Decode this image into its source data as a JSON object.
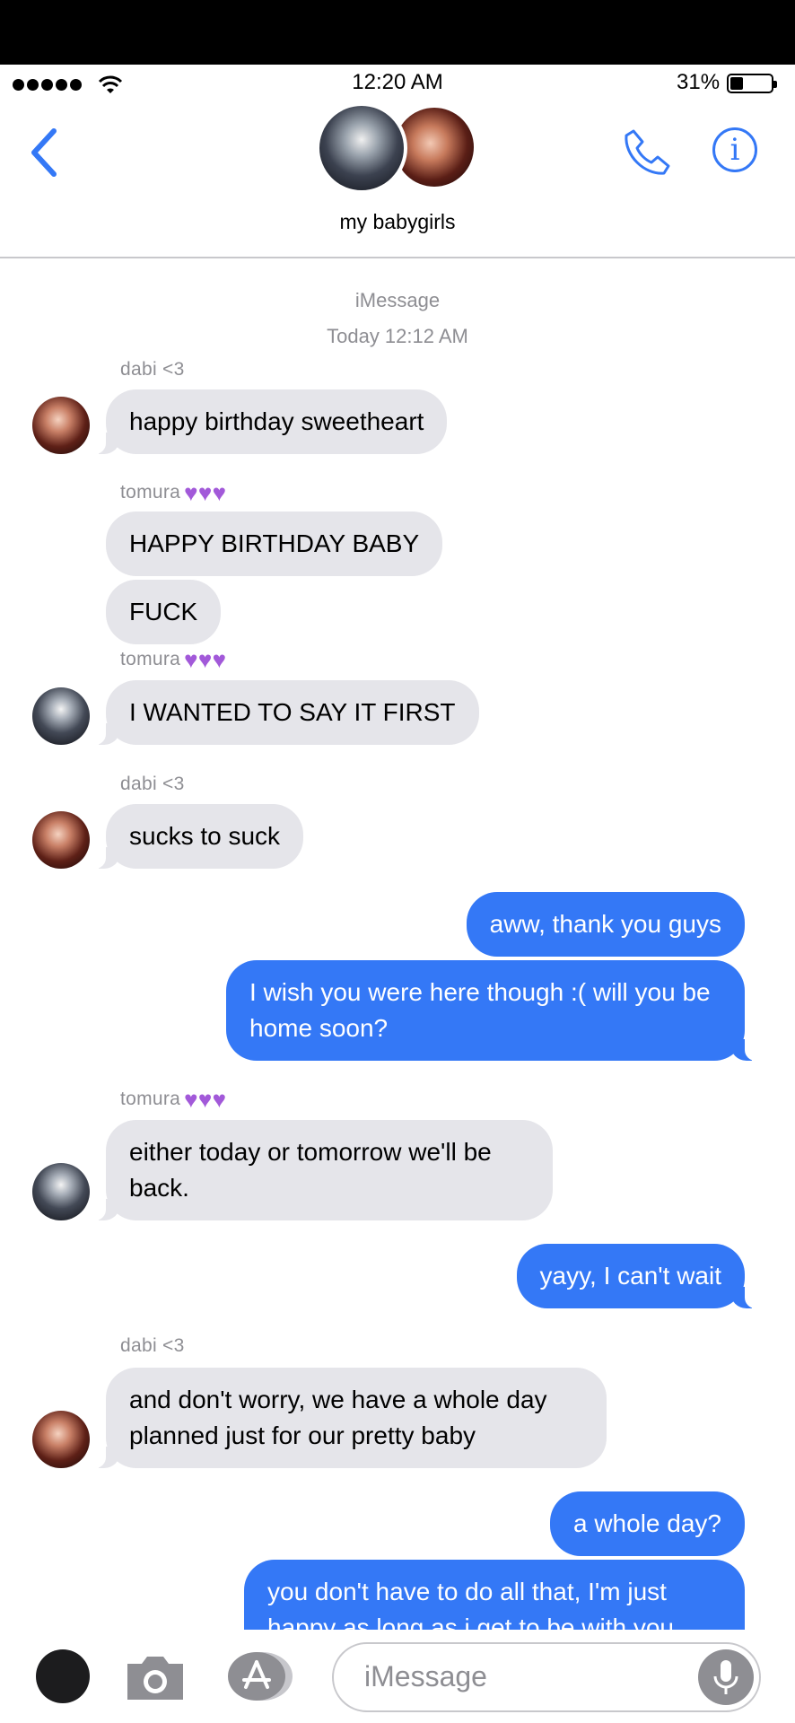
{
  "status": {
    "time": "12:20 AM",
    "battery": "31%"
  },
  "header": {
    "group_name": "my babygirls"
  },
  "thread": {
    "service": "iMessage",
    "date": "Today 12:12 AM",
    "messages": [
      {
        "sender": "dabi <3",
        "text": "happy birthday sweetheart"
      },
      {
        "sender": "tomura",
        "text": "HAPPY BIRTHDAY BABY"
      },
      {
        "text": "FUCK"
      },
      {
        "sender": "tomura",
        "text": "I WANTED TO SAY IT FIRST"
      },
      {
        "sender": "dabi <3",
        "text": "sucks to suck"
      },
      {
        "text": "aww, thank you guys"
      },
      {
        "text": "I wish you were here though :( will you be home soon?"
      },
      {
        "sender": "tomura",
        "text": "either today or tomorrow we'll be back."
      },
      {
        "text": "yayy, I can't wait"
      },
      {
        "sender": "dabi <3",
        "text": "and don't worry, we have a whole day planned just for our pretty baby"
      },
      {
        "text": "a whole day?"
      },
      {
        "text": "you don't have to do all that, I'm just happy as long as i get to be with you"
      }
    ]
  },
  "composer": {
    "placeholder": "iMessage"
  },
  "icons": {
    "signal": "signal-dots-icon",
    "wifi": "wifi-icon",
    "battery": "battery-icon",
    "back": "chevron-left-icon",
    "call": "phone-icon",
    "info": "info-icon",
    "camera": "camera-icon",
    "apps": "app-store-icon",
    "mic": "microphone-icon",
    "heart": "purple-heart"
  },
  "colors": {
    "accent": "#3478f6",
    "incoming_bubble": "#e5e5ea",
    "heart": "#a259d9",
    "meta_text": "#8e8e93"
  }
}
